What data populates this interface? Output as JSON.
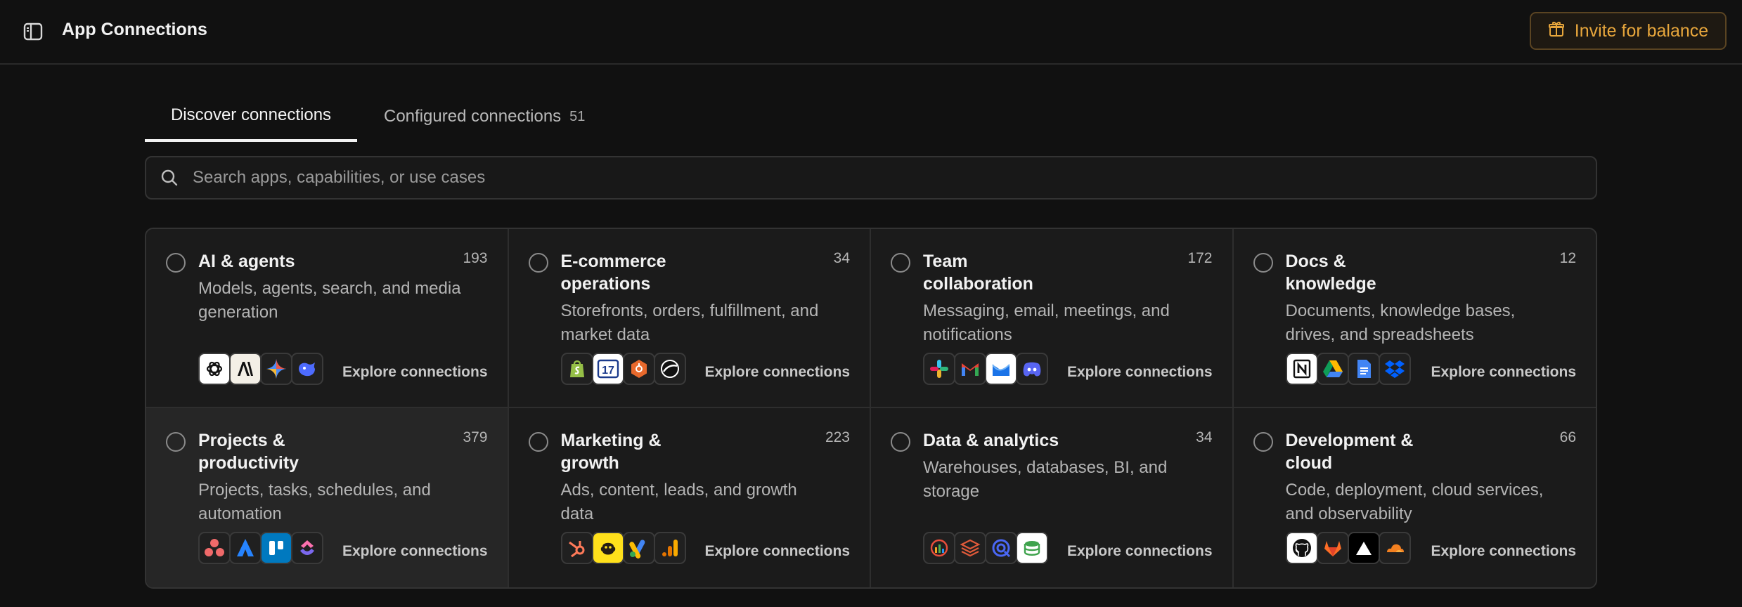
{
  "header": {
    "title": "App Connections",
    "invite_label": "Invite for balance",
    "accent": "#e7a63c"
  },
  "tabs": [
    {
      "label": "Discover connections",
      "active": true
    },
    {
      "label": "Configured connections",
      "count": "51",
      "active": false
    }
  ],
  "search": {
    "placeholder": "Search apps, capabilities, or use cases",
    "value": ""
  },
  "explore_label": "Explore connections",
  "categories": [
    {
      "title": "AI & agents",
      "count": "193",
      "description": "Models, agents, search, and media generation",
      "logos": [
        "openai-icon",
        "anthropic-icon",
        "gemini-icon",
        "deepseek-icon"
      ]
    },
    {
      "title": "E-commerce operations",
      "count": "34",
      "description": "Storefronts, orders, fulfillment, and market data",
      "logos": [
        "shopify-icon",
        "seventeen-track-icon",
        "hexagon-icon",
        "globe-icon"
      ]
    },
    {
      "title": "Team collaboration",
      "count": "172",
      "description": "Messaging, email, meetings, and notifications",
      "logos": [
        "slack-icon",
        "gmail-icon",
        "outlook-icon",
        "discord-icon"
      ]
    },
    {
      "title": "Docs & knowledge",
      "count": "12",
      "description": "Documents, knowledge bases, drives, and spreadsheets",
      "logos": [
        "notion-icon",
        "google-drive-icon",
        "google-docs-icon",
        "dropbox-icon"
      ]
    },
    {
      "title": "Projects & productivity",
      "count": "379",
      "description": "Projects, tasks, schedules, and automation",
      "logos": [
        "asana-icon",
        "jira-icon",
        "trello-icon",
        "clickup-icon"
      ]
    },
    {
      "title": "Marketing & growth",
      "count": "223",
      "description": "Ads, content, leads, and growth data",
      "logos": [
        "hubspot-icon",
        "mailchimp-icon",
        "google-ads-icon",
        "google-analytics-icon"
      ]
    },
    {
      "title": "Data & analytics",
      "count": "34",
      "description": "Warehouses, databases, BI, and storage",
      "logos": [
        "chart-icon",
        "layers-icon",
        "query-icon",
        "database-icon"
      ]
    },
    {
      "title": "Development & cloud",
      "count": "66",
      "description": "Code, deployment, cloud services, and observability",
      "logos": [
        "github-icon",
        "gitlab-icon",
        "vercel-icon",
        "cloudflare-icon"
      ]
    }
  ]
}
